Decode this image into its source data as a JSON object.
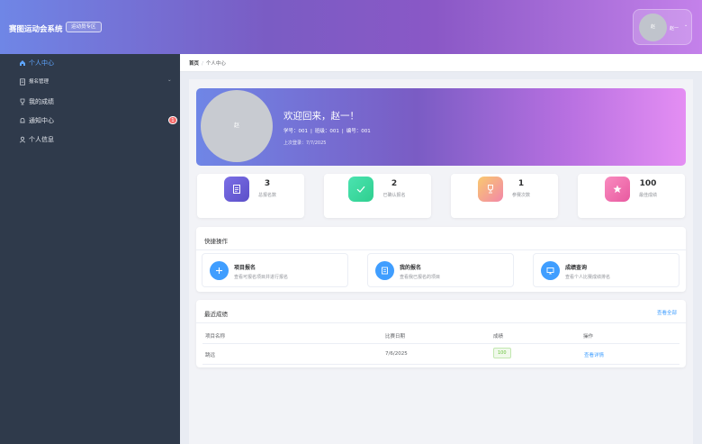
{
  "header": {
    "title": "赛图运动会系统",
    "role_tag": "运动员专区",
    "user": {
      "avatar_text": "赵",
      "name": "赵一",
      "caret": "⌄"
    }
  },
  "sidebar": {
    "items": [
      {
        "label": "个人中心",
        "icon": "home-icon",
        "active": true
      },
      {
        "label": "报名管理",
        "icon": "document-icon",
        "has_submenu": true,
        "chevron": "⌄"
      },
      {
        "label": "我的成绩",
        "icon": "trophy-icon"
      },
      {
        "label": "通知中心",
        "icon": "bell-icon",
        "badge": "1"
      },
      {
        "label": "个人信息",
        "icon": "user-icon"
      }
    ]
  },
  "breadcrumb": {
    "home": "首页",
    "separator": "/",
    "current": "个人中心"
  },
  "welcome": {
    "avatar_text": "赵",
    "greeting": "欢迎回来，赵一！",
    "student_id": "学号：001",
    "class": "班级：001",
    "number": "编号：001",
    "last_login": "上次登录：7/7/2025"
  },
  "stats": [
    {
      "value": "3",
      "label": "总报名数",
      "icon": "document-icon",
      "color": "#6b63d9"
    },
    {
      "value": "2",
      "label": "已确认报名",
      "icon": "check-icon",
      "color": "#3dd6a0"
    },
    {
      "value": "1",
      "label": "参赛次数",
      "icon": "trophy-icon",
      "color": "#f7b96a"
    },
    {
      "value": "100",
      "label": "最佳成绩",
      "icon": "star-icon",
      "color": "#f178b6"
    }
  ],
  "quick_actions": {
    "title": "快捷操作",
    "items": [
      {
        "title": "项目报名",
        "desc": "查看可报名项目并进行报名",
        "icon": "plus-icon"
      },
      {
        "title": "我的报名",
        "desc": "查看我已报名的项目",
        "icon": "list-icon"
      },
      {
        "title": "成绩查询",
        "desc": "查看个人比赛成绩排名",
        "icon": "chart-icon"
      }
    ]
  },
  "recent_scores": {
    "title": "最近成绩",
    "view_all": "查看全部",
    "columns": [
      "项目名称",
      "比赛日期",
      "成绩",
      "操作"
    ],
    "rows": [
      {
        "name": "跳远",
        "date": "7/6/2025",
        "score": "100",
        "action": "查看详情"
      }
    ]
  }
}
